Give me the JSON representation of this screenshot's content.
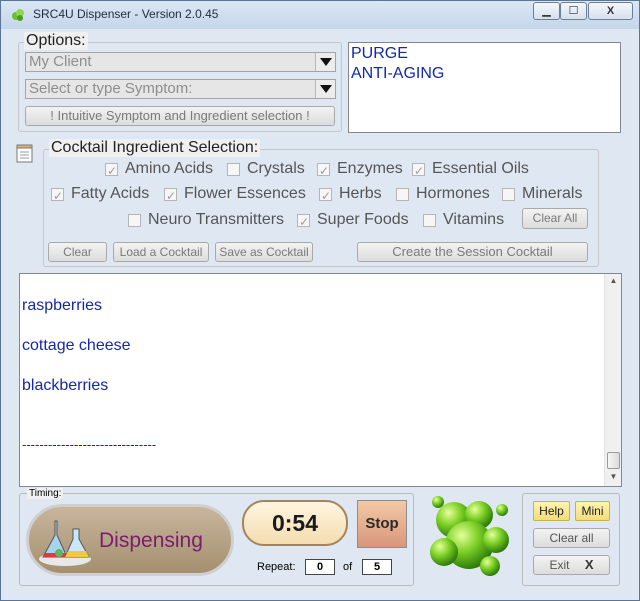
{
  "window": {
    "title": "SRC4U Dispenser - Version 2.0.45",
    "controls": {
      "minimize": "▁",
      "maximize": "☐",
      "close": "X"
    }
  },
  "options": {
    "label": "Options:",
    "client_placeholder": "My Client",
    "symptom_placeholder": "Select or type Symptom:",
    "intuitive_button": "! Intuitive Symptom and Ingredient selection !"
  },
  "selected_list": [
    "PURGE",
    "ANTI-AGING"
  ],
  "cocktail": {
    "label": "Cocktail Ingredient Selection:",
    "checkboxes": [
      {
        "label": "Amino Acids",
        "checked": true
      },
      {
        "label": "Crystals",
        "checked": false
      },
      {
        "label": "Enzymes",
        "checked": true
      },
      {
        "label": "Essential Oils",
        "checked": true
      },
      {
        "label": "Fatty Acids",
        "checked": true
      },
      {
        "label": "Flower Essences",
        "checked": true
      },
      {
        "label": "Herbs",
        "checked": true
      },
      {
        "label": "Hormones",
        "checked": false
      },
      {
        "label": "Minerals",
        "checked": false
      },
      {
        "label": "Neuro Transmitters",
        "checked": false
      },
      {
        "label": "Super Foods",
        "checked": true
      },
      {
        "label": "Vitamins",
        "checked": false
      }
    ],
    "clear_all": "Clear All",
    "clear": "Clear",
    "load": "Load a Cocktail",
    "save": "Save as Cocktail",
    "create": "Create the Session Cocktail"
  },
  "ingredients": [
    "raspberries",
    "cottage cheese",
    "blackberries",
    "-------------------------------"
  ],
  "timing": {
    "label": "Timing:",
    "status": "Dispensing",
    "time": "0:54",
    "stop": "Stop",
    "repeat_label": "Repeat:",
    "repeat_value": "0",
    "of_label": "of",
    "repeat_total": "5"
  },
  "side_buttons": {
    "help": "Help",
    "mini": "Mini",
    "clear_all": "Clear all",
    "exit": "Exit",
    "exit_icon": "X"
  },
  "colors": {
    "accent_blue": "#1428a8",
    "timer_border": "#a5845a",
    "dispensing_text": "#7a1d6e"
  }
}
